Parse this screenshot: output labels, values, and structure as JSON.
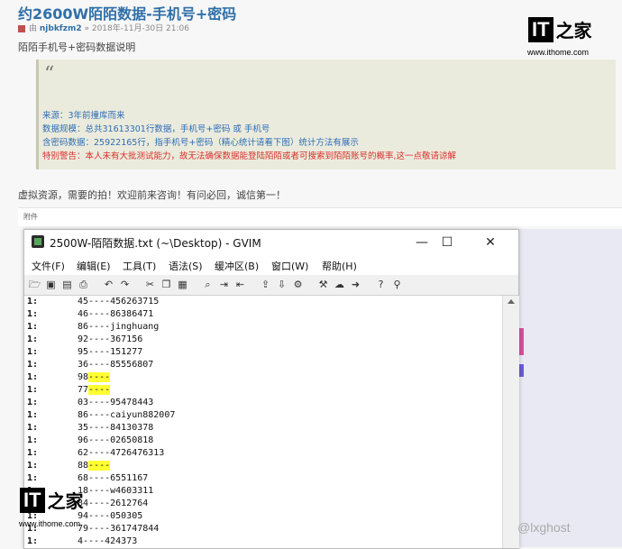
{
  "post": {
    "title": "约2600W陌陌数据-手机号+密码",
    "meta_prefix": "由",
    "author": "njbkfzm2",
    "date": "» 2018年-11月-30日 21:06",
    "subtitle": "陌陌手机号+密码数据说明",
    "quote_mark": "“",
    "quote_lines": [
      "来源：3年前撞库而来",
      "数据规模：总共31613301行数据，手机号+密码 或 手机号",
      "含密码数据：25922165行，指手机号+密码（精心统计请看下图）统计方法有展示",
      "特别警告：本人未有大批测试能力，故无法确保数据能登陆陌陌或者可搜索到陌陌账号的概率,这一点敬请谅解"
    ],
    "promo": "虚拟资源，需要的拍！欢迎前来咨询！有问必回，诚信第一！",
    "attach_label": "附件"
  },
  "logo": {
    "it": "IT",
    "zh": "之家",
    "url": "www.ithome.com"
  },
  "gvim": {
    "title": "2500W-陌陌数据.txt (~\\Desktop) - GVIM",
    "minimize": "—",
    "maximize": "☐",
    "close": "✕",
    "menus": [
      "文件(F)",
      "编辑(E)",
      "工具(T)",
      "语法(S)",
      "缓冲区(B)",
      "窗口(W)",
      "帮助(H)"
    ],
    "toolbar_icons": [
      "open-icon",
      "save-icon",
      "save-all-icon",
      "print-icon",
      "undo-icon",
      "redo-icon",
      "cut-icon",
      "copy-icon",
      "paste-icon",
      "find-icon",
      "find-next-icon",
      "find-prev-icon",
      "load-session-icon",
      "save-session-icon",
      "run-script-icon",
      "make-icon",
      "shell-icon",
      "tag-jump-icon",
      "help-icon",
      "find-help-icon"
    ],
    "lines": [
      {
        "n": "1:",
        "a": "45----",
        "b": "456263715",
        "hl": false
      },
      {
        "n": "1:",
        "a": "46----",
        "b": "86386471",
        "hl": false
      },
      {
        "n": "1:",
        "a": "86----",
        "b": "jinghuang",
        "hl": false
      },
      {
        "n": "1:",
        "a": "92----",
        "b": "367156",
        "hl": false
      },
      {
        "n": "1:",
        "a": "95----",
        "b": "151277",
        "hl": false
      },
      {
        "n": "1:",
        "a": "36----",
        "b": "85556807",
        "hl": false
      },
      {
        "n": "1:",
        "a": "98",
        "b": "----",
        "hl": true
      },
      {
        "n": "1:",
        "a": "77",
        "b": "----",
        "hl": true
      },
      {
        "n": "1:",
        "a": "03----",
        "b": "95478443",
        "hl": false
      },
      {
        "n": "1:",
        "a": "86----",
        "b": "caiyun882007",
        "hl": false
      },
      {
        "n": "1:",
        "a": "35----",
        "b": "84130378",
        "hl": false
      },
      {
        "n": "1:",
        "a": "96----",
        "b": "02650818",
        "hl": false
      },
      {
        "n": "1:",
        "a": "62----",
        "b": "4726476313",
        "hl": false
      },
      {
        "n": "1:",
        "a": "88",
        "b": "----",
        "hl": true
      },
      {
        "n": "1:",
        "a": "68----",
        "b": "6551167",
        "hl": false
      },
      {
        "n": "1:",
        "a": "18----",
        "b": "w4603311",
        "hl": false
      },
      {
        "n": "1:",
        "a": "84----",
        "b": "2612764",
        "hl": false
      },
      {
        "n": "1:",
        "a": "94----",
        "b": "050305",
        "hl": false
      },
      {
        "n": "1:",
        "a": "79----",
        "b": "361747844",
        "hl": false
      },
      {
        "n": "1:",
        "a": "4----",
        "b": "424373",
        "hl": false
      }
    ]
  },
  "watermark": "@lxghost"
}
